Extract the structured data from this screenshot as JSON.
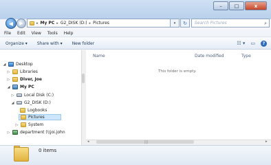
{
  "window": {
    "title_buttons": {
      "minimize": "–",
      "maximize": "□",
      "close": "x"
    }
  },
  "address_bar": {
    "crumbs": [
      "My PC",
      "G2_DISK (D:)",
      "Pictures"
    ],
    "search_placeholder": "Search Pictures"
  },
  "menu": [
    "File",
    "Edit",
    "View",
    "Tools",
    "Help"
  ],
  "toolbar": {
    "organize": "Organize ▾",
    "share": "Share with ▾",
    "new_folder": "New folder"
  },
  "columns": {
    "name": "Name",
    "date_modified": "Date modified",
    "type": "Type"
  },
  "empty_message": "This folder is empty.",
  "nav_tree": [
    {
      "label": "Desktop",
      "icon": "desktop-icon"
    },
    {
      "label": "Libraries",
      "icon": "libraries-icon"
    },
    {
      "label": "Diver, Joe",
      "icon": "user-folder-icon"
    },
    {
      "label": "My PC",
      "icon": "computer-icon"
    },
    {
      "label": "Local Disk (C:)",
      "icon": "drive-icon"
    },
    {
      "label": "G2_DISK (D:)",
      "icon": "drive-icon"
    },
    {
      "label": "Logbooks",
      "icon": "folder-icon"
    },
    {
      "label": "Pictures",
      "icon": "folder-icon"
    },
    {
      "label": "System",
      "icon": "folder-icon"
    },
    {
      "label": "department (\\\\joi.john",
      "icon": "network-drive-icon"
    }
  ],
  "details": {
    "count": "0 items"
  }
}
